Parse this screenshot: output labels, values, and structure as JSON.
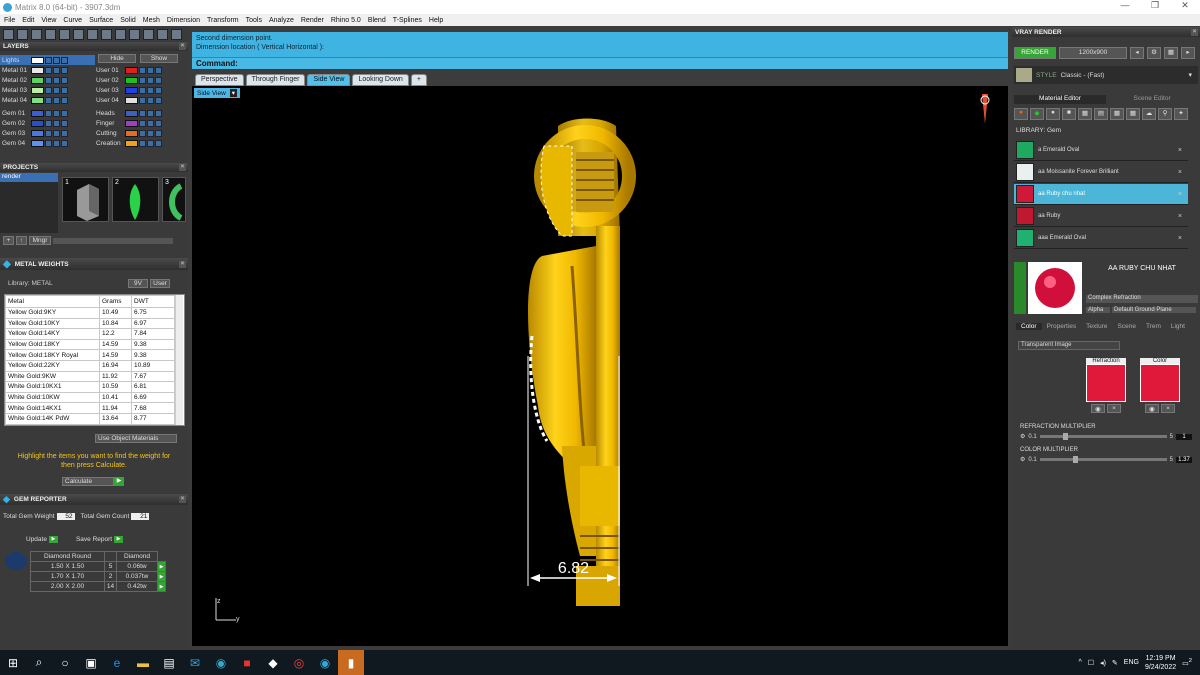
{
  "window": {
    "title": "Matrix 8.0 (64-bit) - 3907.3dm",
    "controls": [
      "—",
      "❐",
      "✕"
    ]
  },
  "menu": [
    "File",
    "Edit",
    "View",
    "Curve",
    "Surface",
    "Solid",
    "Mesh",
    "Dimension",
    "Transform",
    "Tools",
    "Analyze",
    "Render",
    "Rhino 5.0",
    "Blend",
    "T-Splines",
    "Help"
  ],
  "layers": {
    "title": "LAYERS",
    "hide": "Hide",
    "show": "Show",
    "left": [
      {
        "name": "Lights",
        "color": "#ffffff",
        "selected": true
      },
      {
        "name": "Metal 01",
        "color": "#e8e8e8"
      },
      {
        "name": "Metal 02",
        "color": "#5fd35f"
      },
      {
        "name": "Metal 03",
        "color": "#b8f0a0"
      },
      {
        "name": "Metal 04",
        "color": "#80e080"
      },
      {
        "name": "Gem 01",
        "color": "#3c5fd0"
      },
      {
        "name": "Gem 02",
        "color": "#2850c8"
      },
      {
        "name": "Gem 03",
        "color": "#4a78e0"
      },
      {
        "name": "Gem 04",
        "color": "#6090f0"
      }
    ],
    "right": [
      {
        "name": "User 01",
        "color": "#e02020"
      },
      {
        "name": "User 02",
        "color": "#20c020"
      },
      {
        "name": "User 03",
        "color": "#2040e0"
      },
      {
        "name": "User 04",
        "color": "#e0e0e0"
      },
      {
        "name": "Heads",
        "color": "#4060c0"
      },
      {
        "name": "Finger",
        "color": "#a040c0"
      },
      {
        "name": "Cutting",
        "color": "#e07020"
      },
      {
        "name": "Creation",
        "color": "#f0a020"
      }
    ]
  },
  "projects": {
    "title": "PROJECTS",
    "item": "render",
    "thumbs": [
      "1",
      "2",
      "3"
    ],
    "mngr": "Mngr"
  },
  "metal_weights": {
    "title": "METAL WEIGHTS",
    "library_label": "Library: METAL",
    "tab_9v": "9V",
    "tab_user": "User",
    "columns": [
      "Metal",
      "Grams",
      "DWT"
    ],
    "rows": [
      [
        "Yellow Gold:9KY",
        "10.49",
        "6.75"
      ],
      [
        "Yellow Gold:10KY",
        "10.84",
        "6.97"
      ],
      [
        "Yellow Gold:14KY",
        "12.2",
        "7.84"
      ],
      [
        "Yellow Gold:18KY",
        "14.59",
        "9.38"
      ],
      [
        "Yellow Gold:18KY Royal",
        "14.59",
        "9.38"
      ],
      [
        "Yellow Gold:22KY",
        "16.94",
        "10.89"
      ],
      [
        "White Gold:9KW",
        "11.92",
        "7.67"
      ],
      [
        "White Gold:10KX1",
        "10.59",
        "6.81"
      ],
      [
        "White Gold:10KW",
        "10.41",
        "6.69"
      ],
      [
        "White Gold:14KX1",
        "11.94",
        "7.68"
      ],
      [
        "White Gold:14K PdW",
        "13.64",
        "8.77"
      ]
    ],
    "use_object": "Use Object Materials",
    "hint": "Highlight the items you want to find the weight for then press Calculate.",
    "calculate": "Calculate"
  },
  "gem_reporter": {
    "title": "GEM REPORTER",
    "total_weight_label": "Total Gem Weight",
    "total_weight": "52",
    "total_count_label": "Total Gem Count",
    "total_count": "21",
    "update": "Update",
    "save_report": "Save Report",
    "columns": [
      "Diamond Round",
      "",
      "Diamond"
    ],
    "rows": [
      [
        "1.50 X 1.50",
        "5",
        "0.06tw"
      ],
      [
        "1.70 X 1.70",
        "2",
        "0.037tw"
      ],
      [
        "2.00 X 2.00",
        "14",
        "0.42tw"
      ]
    ]
  },
  "prompt": {
    "line1": "Second dimension point.",
    "line2": "Dimension location ( Vertical  Horizontal ):",
    "command_label": "Command:"
  },
  "tabs": [
    {
      "label": "Perspective"
    },
    {
      "label": "Through Finger"
    },
    {
      "label": "Side View",
      "active": true
    },
    {
      "label": "Looking Down"
    },
    {
      "label": "+"
    }
  ],
  "viewport": {
    "label": "Side View",
    "dimension": "6.82",
    "axis_z": "z",
    "axis_y": "y"
  },
  "vray": {
    "title": "VRAY RENDER",
    "render": "RENDER",
    "resolution": "1200x900",
    "style_label": "STYLE",
    "style_value": "Classic - (Fast)",
    "tabs": [
      "Material Editor",
      "Scene Editor"
    ],
    "library_label": "LIBRARY: Gem",
    "materials": [
      {
        "name": "a Emerald Oval",
        "color": "#1ea860"
      },
      {
        "name": "aa Moissanite Forever Brilliant",
        "color": "#e8f0f0"
      },
      {
        "name": "aa Ruby chu nhat",
        "color": "#d01838",
        "selected": true
      },
      {
        "name": "aa Ruby",
        "color": "#c01830"
      },
      {
        "name": "aaa Emerald Oval",
        "color": "#20b070"
      }
    ],
    "preview_title": "AA RUBY CHU NHAT",
    "mode": "Complex Refraction",
    "alpha": "Alpha",
    "ground": "Default Ground Plane",
    "subtabs": [
      "Color",
      "Properties",
      "Texture",
      "Scene",
      "Trem",
      "Light"
    ],
    "transparent": "Transparent Image",
    "refraction_label": "Refraction",
    "color_label": "Color",
    "refr_mult_label": "REFRACTION MULTIPLIER",
    "refr_min": "0.1",
    "refr_max": "5",
    "refr_val": "1",
    "color_mult_label": "COLOR MULTIPLIER",
    "col_min": "0.1",
    "col_max": "5",
    "col_val": "1.37"
  },
  "taskbar": {
    "time": "12:19 PM",
    "date": "9/24/2022",
    "lang": "ENG",
    "notif": "2"
  }
}
